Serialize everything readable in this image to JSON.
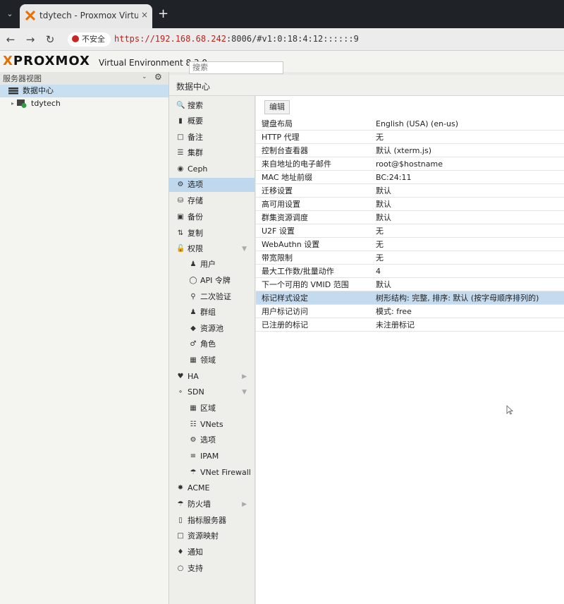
{
  "browser": {
    "tab_title": "tdytech - Proxmox Virtual En",
    "tab_close": "×",
    "new_tab": "+",
    "security_label": "不安全",
    "url_host": "https://192.168.68.242",
    "url_rest": ":8006/#v1:0:18:4:12::::::9"
  },
  "header": {
    "logo": "PROXMOX",
    "product": "Virtual Environment 8.3.0",
    "search_placeholder": "搜索"
  },
  "tree": {
    "view_label": "服务器视图",
    "datacenter": "数据中心",
    "node": "tdytech"
  },
  "content": {
    "title": "数据中心",
    "edit_button": "编辑"
  },
  "menu": [
    {
      "label": "搜索",
      "icon": "search-icon"
    },
    {
      "label": "概要",
      "icon": "book-icon"
    },
    {
      "label": "备注",
      "icon": "note-icon"
    },
    {
      "label": "集群",
      "icon": "server-icon"
    },
    {
      "label": "Ceph",
      "icon": "ceph-icon"
    },
    {
      "label": "选项",
      "icon": "gear-icon"
    },
    {
      "label": "存储",
      "icon": "database-icon"
    },
    {
      "label": "备份",
      "icon": "floppy-icon"
    },
    {
      "label": "复制",
      "icon": "retweet-icon"
    },
    {
      "label": "权限",
      "icon": "unlock-icon"
    },
    {
      "label": "用户",
      "icon": "user-icon"
    },
    {
      "label": "API 令牌",
      "icon": "user-o-icon"
    },
    {
      "label": "二次验证",
      "icon": "key-icon"
    },
    {
      "label": "群组",
      "icon": "users-icon"
    },
    {
      "label": "资源池",
      "icon": "tags-icon"
    },
    {
      "label": "角色",
      "icon": "male-icon"
    },
    {
      "label": "领域",
      "icon": "address-book-icon"
    },
    {
      "label": "HA",
      "icon": "heartbeat-icon"
    },
    {
      "label": "SDN",
      "icon": "share-alt-icon"
    },
    {
      "label": "区域",
      "icon": "th-icon"
    },
    {
      "label": "VNets",
      "icon": "sitemap-icon"
    },
    {
      "label": "选项",
      "icon": "gear-icon"
    },
    {
      "label": "IPAM",
      "icon": "ipam-icon"
    },
    {
      "label": "VNet Firewall",
      "icon": "shield-icon"
    },
    {
      "label": "ACME",
      "icon": "certificate-icon"
    },
    {
      "label": "防火墙",
      "icon": "shield-icon"
    },
    {
      "label": "指标服务器",
      "icon": "bar-chart-icon"
    },
    {
      "label": "资源映射",
      "icon": "folder-icon"
    },
    {
      "label": "通知",
      "icon": "bell-icon"
    },
    {
      "label": "支持",
      "icon": "comments-icon"
    }
  ],
  "options": [
    {
      "key": "键盘布局",
      "value": "English (USA) (en-us)"
    },
    {
      "key": "HTTP 代理",
      "value": "无"
    },
    {
      "key": "控制台查看器",
      "value": "默认 (xterm.js)"
    },
    {
      "key": "来自地址的电子邮件",
      "value": "root@$hostname"
    },
    {
      "key": "MAC 地址前缀",
      "value": "BC:24:11"
    },
    {
      "key": "迁移设置",
      "value": "默认"
    },
    {
      "key": "高可用设置",
      "value": "默认"
    },
    {
      "key": "群集资源调度",
      "value": "默认"
    },
    {
      "key": "U2F 设置",
      "value": "无"
    },
    {
      "key": "WebAuthn 设置",
      "value": "无"
    },
    {
      "key": "带宽限制",
      "value": "无"
    },
    {
      "key": "最大工作数/批量动作",
      "value": "4"
    },
    {
      "key": "下一个可用的 VMID 范围",
      "value": "默认"
    },
    {
      "key": "标记样式设定",
      "value": "树形结构: 完整, 排序: 默认 (按字母顺序排列的)"
    },
    {
      "key": "用户标记访问",
      "value": "模式: free"
    },
    {
      "key": "已注册的标记",
      "value": "未注册标记"
    }
  ],
  "colors": {
    "accent": "#e57000",
    "selection": "#bfd8ee"
  }
}
